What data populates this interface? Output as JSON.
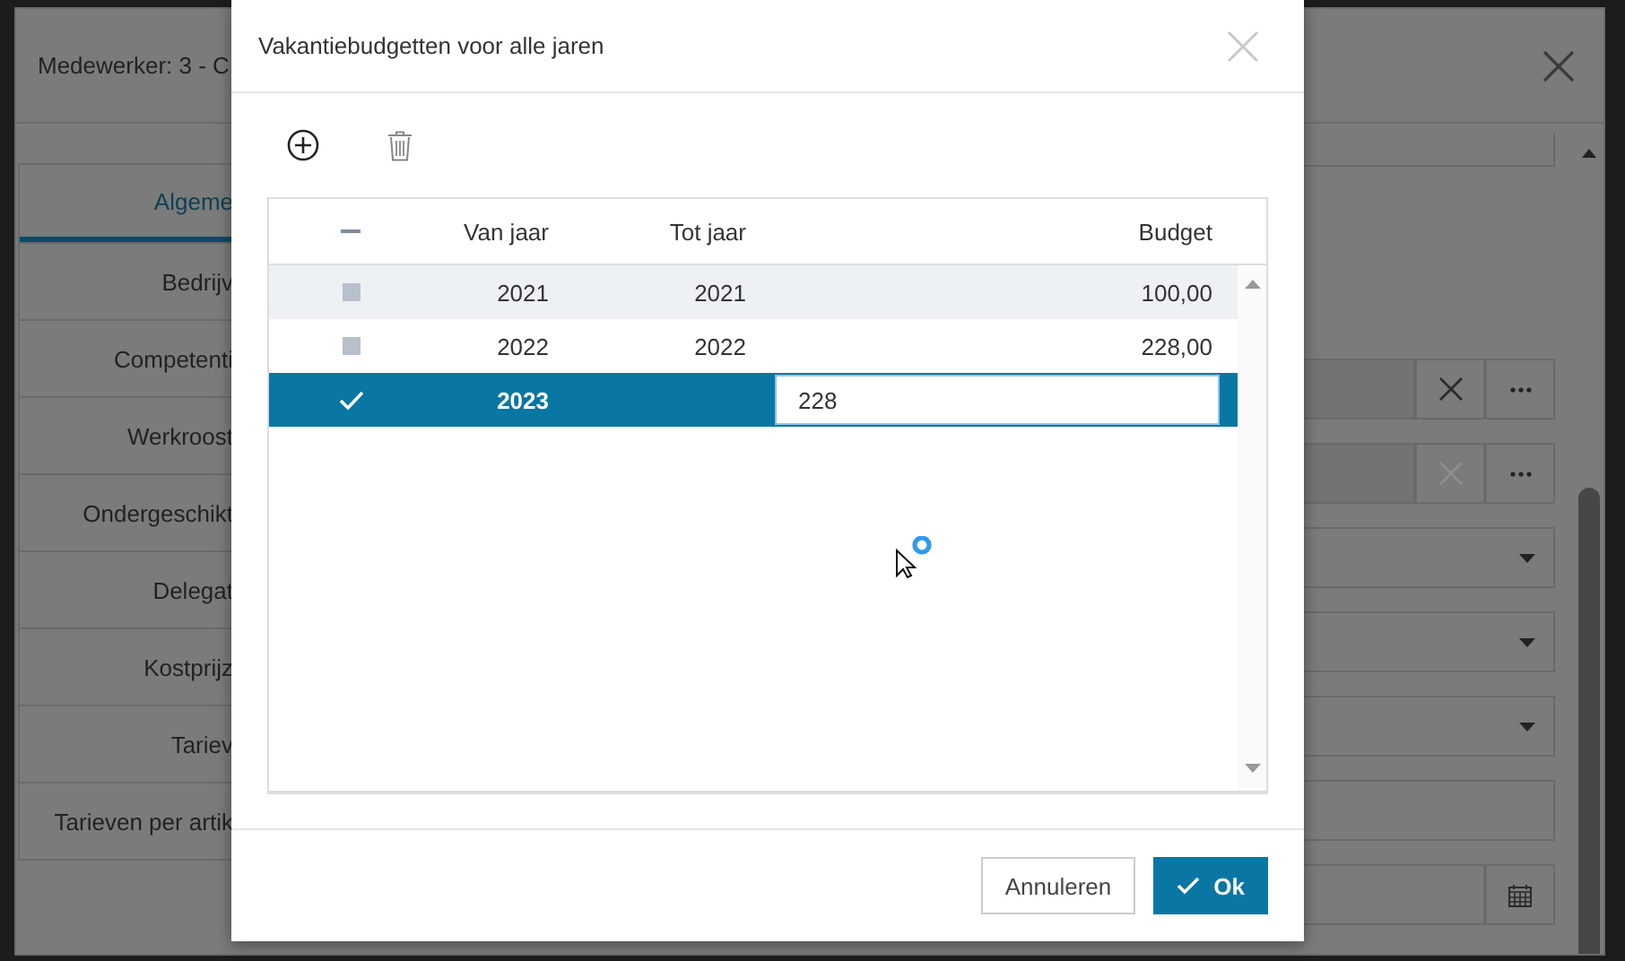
{
  "background_window": {
    "title": "Medewerker: 3 - C",
    "tabs": [
      {
        "label": "Algeme",
        "selected": true
      },
      {
        "label": "Bedrijv",
        "selected": false
      },
      {
        "label": "Competenti",
        "selected": false
      },
      {
        "label": "Werkroost",
        "selected": false
      },
      {
        "label": "Ondergeschikt",
        "selected": false
      },
      {
        "label": "Delegat",
        "selected": false
      },
      {
        "label": "Kostprijz",
        "selected": false
      },
      {
        "label": "Tariev",
        "selected": false
      },
      {
        "label": "Tarieven per artik",
        "selected": false
      }
    ],
    "fields": [
      {
        "kind": "lookup",
        "clear_disabled": false
      },
      {
        "kind": "lookup",
        "clear_disabled": true
      },
      {
        "kind": "dropdown"
      },
      {
        "kind": "dropdown"
      },
      {
        "kind": "dropdown"
      },
      {
        "kind": "text"
      },
      {
        "kind": "date"
      }
    ]
  },
  "dialog": {
    "title": "Vakantiebudgetten voor alle jaren",
    "columns": [
      "Van jaar",
      "Tot jaar",
      "Budget"
    ],
    "rows": [
      {
        "kind": "display",
        "selected": false,
        "highlighted": true,
        "van_jaar": "2021",
        "tot_jaar": "2021",
        "budget": "100,00"
      },
      {
        "kind": "display",
        "selected": false,
        "highlighted": false,
        "van_jaar": "2022",
        "tot_jaar": "2022",
        "budget": "228,00"
      },
      {
        "kind": "edit",
        "selected": true,
        "highlighted": false,
        "van_jaar": "2023",
        "budget": "228"
      }
    ],
    "buttons": [
      {
        "kind": "secondary",
        "label": "Annuleren"
      },
      {
        "kind": "primary",
        "label": "Ok"
      }
    ]
  }
}
